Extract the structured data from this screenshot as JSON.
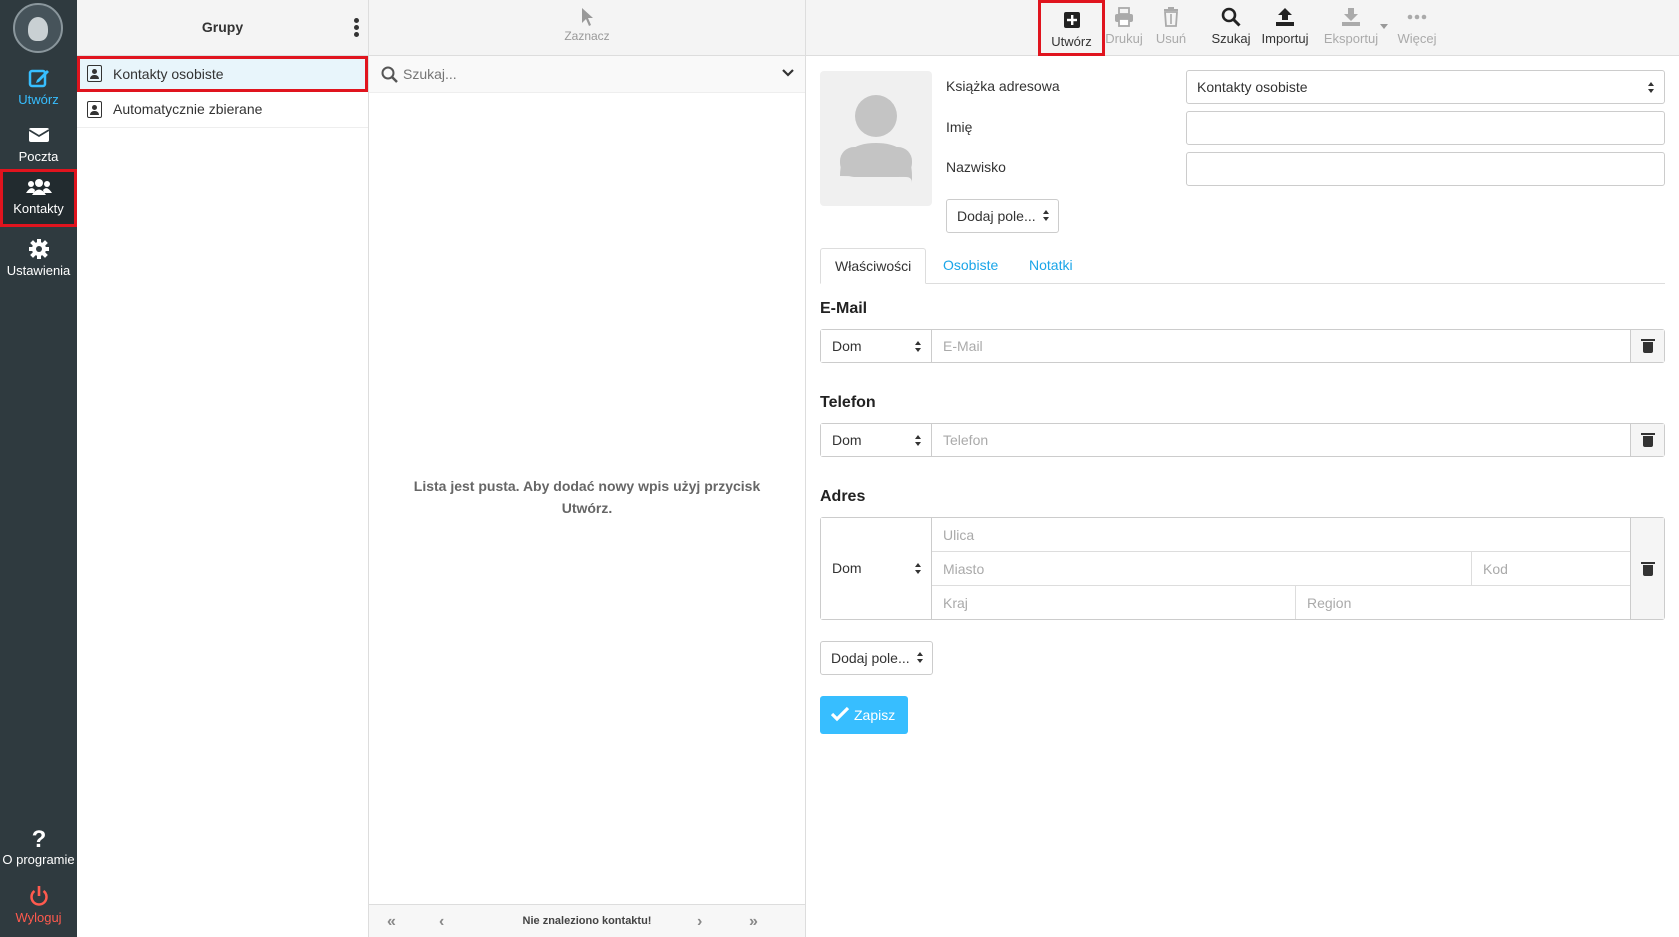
{
  "nav": {
    "items": [
      {
        "label": "Utwórz",
        "icon": "compose-icon"
      },
      {
        "label": "Poczta",
        "icon": "envelope-icon"
      },
      {
        "label": "Kontakty",
        "icon": "users-icon"
      },
      {
        "label": "Ustawienia",
        "icon": "gear-icon"
      }
    ],
    "bottom": [
      {
        "label": "O programie",
        "icon": "question-icon"
      },
      {
        "label": "Wyloguj",
        "icon": "power-icon"
      }
    ]
  },
  "groups": {
    "title": "Grupy",
    "items": [
      {
        "label": "Kontakty osobiste",
        "selected": true
      },
      {
        "label": "Automatycznie zbierane",
        "selected": false
      }
    ]
  },
  "list": {
    "select_label": "Zaznacz",
    "search_placeholder": "Szukaj...",
    "empty_message": "Lista jest pusta. Aby dodać nowy wpis użyj przycisk Utwórz.",
    "pager_text": "Nie znaleziono kontaktu!"
  },
  "toolbar": {
    "create": "Utwórz",
    "print": "Drukuj",
    "delete": "Usuń",
    "search": "Szukaj",
    "import": "Importuj",
    "export": "Eksportuj",
    "more": "Więcej"
  },
  "form": {
    "addressbook_label": "Książka adresowa",
    "addressbook_value": "Kontakty osobiste",
    "firstname_label": "Imię",
    "lastname_label": "Nazwisko",
    "add_field": "Dodaj pole...",
    "tabs": [
      "Właściwości",
      "Osobiste",
      "Notatki"
    ],
    "email": {
      "title": "E-Mail",
      "type": "Dom",
      "placeholder": "E-Mail"
    },
    "phone": {
      "title": "Telefon",
      "type": "Dom",
      "placeholder": "Telefon"
    },
    "address": {
      "title": "Adres",
      "type": "Dom",
      "street": "Ulica",
      "city": "Miasto",
      "zip": "Kod",
      "country": "Kraj",
      "region": "Region"
    },
    "add_field_bottom": "Dodaj pole...",
    "save": "Zapisz"
  },
  "colors": {
    "nav_bg": "#2f3a3f",
    "accent": "#37beff",
    "highlight": "#e0141e"
  }
}
